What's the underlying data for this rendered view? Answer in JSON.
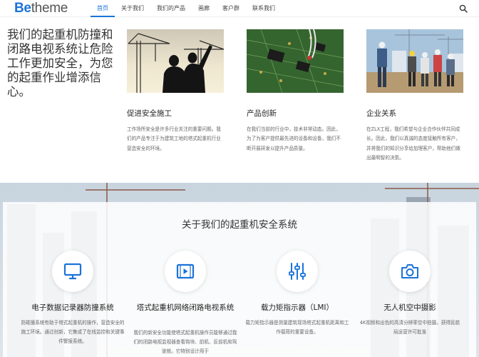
{
  "header": {
    "logo_be": "Be",
    "logo_rest": "theme",
    "nav": [
      "首页",
      "关于我们",
      "我们的产品",
      "画廊",
      "客户群",
      "联系我们"
    ],
    "active_index": 0,
    "accent": "#1a73d9"
  },
  "hero": {
    "text": "我们的起重机防撞和闭路电视系统让危险工作更加安全，为您的起重作业增添信心。"
  },
  "features": [
    {
      "image": "silhouette-engineers-cranes",
      "title": "促进安全施工",
      "desc": "工作场所安全是许多行业关注的重要问题。我们的产品专注于为建筑工地的塔式起重机行业营造安全的环境。"
    },
    {
      "image": "circuit-board",
      "title": "产品创新",
      "desc": "在我们当前的行业中，技术非常动态。因此，为了为客户提供最先进的设备和设备，我们不断开展研发以提升产品质量。"
    },
    {
      "image": "construction-workers",
      "title": "企业关系",
      "desc": "在ZLX工程，我们希望与企业合作伙伴共同成长。因此，我们以真诚的态度接触所有客户，并将我们的知识分享给加理客户，帮助他们做出最明智的决策。"
    }
  ],
  "about": {
    "title": "关于我们的起重机安全系统",
    "services": [
      {
        "icon": "monitor-icon",
        "title": "电子数据记录器防撞系统",
        "desc": "防碰撞系统有助于塔式起重机的操作，营造安全的施工环境。通过创新，它集成了在线监控和关键事件警报系统。"
      },
      {
        "icon": "video-icon",
        "title": "塔式起重机网络闭路电视系统",
        "desc": "我们的新安全功能使塔式起重机操作员能够通过我们的闭路电视监视器查看钩块、前机、反前机和驾驶舱。它特别设计用于"
      },
      {
        "icon": "sliders-icon",
        "title": "载力矩指示器（LMI）",
        "desc": "载力矩指示器是测量建筑现场塔式起重机距离和工作载荷的重要设备。"
      },
      {
        "icon": "camera-icon",
        "title": "无人机空中摄影",
        "desc": "4K视频和出色的高清分辨率空中拍摄，获得民航局运营许可批准"
      }
    ]
  }
}
